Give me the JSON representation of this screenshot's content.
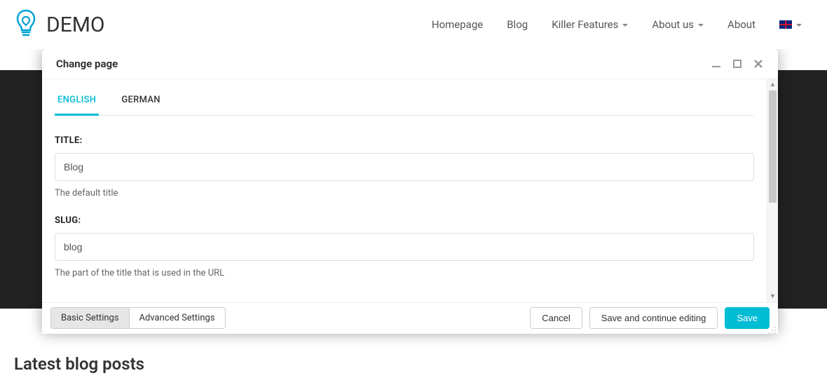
{
  "brand": {
    "title": "DEMO"
  },
  "nav": {
    "items": [
      {
        "label": "Homepage",
        "has_dropdown": false
      },
      {
        "label": "Blog",
        "has_dropdown": false
      },
      {
        "label": "Killer Features",
        "has_dropdown": true
      },
      {
        "label": "About us",
        "has_dropdown": true
      },
      {
        "label": "About",
        "has_dropdown": false
      }
    ],
    "language_switch": {
      "flag": "gb",
      "has_dropdown": true
    }
  },
  "page_heading": "Latest blog posts",
  "modal": {
    "title": "Change page",
    "language_tabs": [
      {
        "label": "ENGLISH",
        "active": true
      },
      {
        "label": "GERMAN",
        "active": false
      }
    ],
    "fields": {
      "title": {
        "label": "TITLE:",
        "value": "Blog",
        "help": "The default title"
      },
      "slug": {
        "label": "SLUG:",
        "value": "blog",
        "help": "The part of the title that is used in the URL"
      }
    },
    "footer": {
      "segments": [
        {
          "label": "Basic Settings",
          "active": true
        },
        {
          "label": "Advanced Settings",
          "active": false
        }
      ],
      "buttons": {
        "cancel": "Cancel",
        "save_continue": "Save and continue editing",
        "save": "Save"
      }
    }
  }
}
